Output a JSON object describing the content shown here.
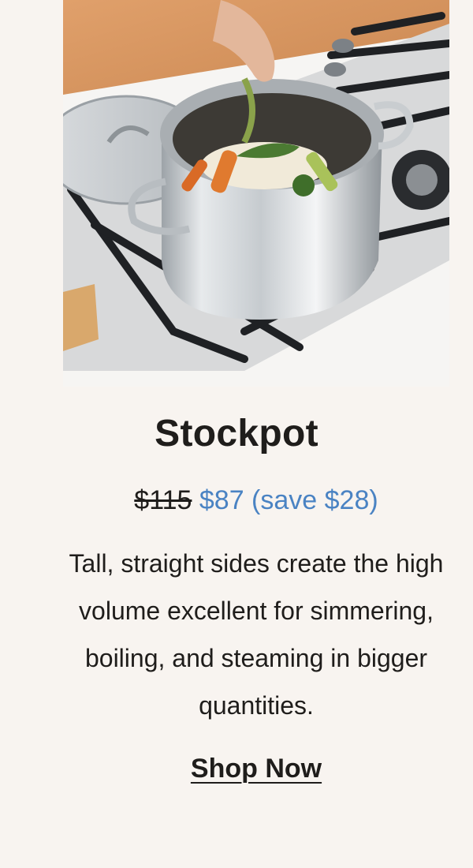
{
  "product": {
    "image_alt": "Stockpot on a stove with vegetables",
    "title": "Stockpot",
    "price_original": "$115",
    "price_sale": "$87 (save $28)",
    "description": "Tall, straight sides create the high volume excellent for simmering, boiling, and steaming in bigger quantities.",
    "cta_label": "Shop Now"
  },
  "colors": {
    "background": "#f8f4f0",
    "sale_price": "#4a83c3",
    "text": "#1f1d1b"
  }
}
